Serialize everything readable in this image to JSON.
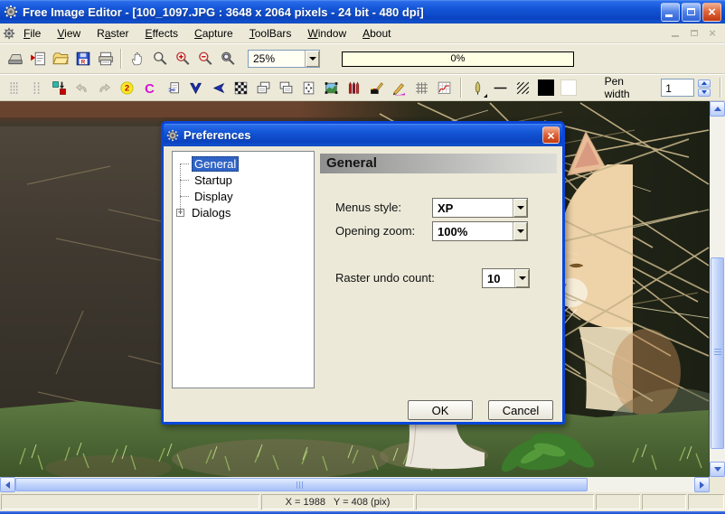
{
  "window": {
    "title": "Free Image Editor - [100_1097.JPG : 3648 x 2064 pixels - 24 bit - 480 dpi]",
    "controls": [
      "minimize",
      "restore",
      "close"
    ]
  },
  "menu": {
    "items": [
      {
        "label": "File",
        "mnemonic": "F"
      },
      {
        "label": "View",
        "mnemonic": "V"
      },
      {
        "label": "Raster",
        "mnemonic": "a"
      },
      {
        "label": "Effects",
        "mnemonic": "E"
      },
      {
        "label": "Capture",
        "mnemonic": "C"
      },
      {
        "label": "ToolBars",
        "mnemonic": "T"
      },
      {
        "label": "Window",
        "mnemonic": "W"
      },
      {
        "label": "About",
        "mnemonic": "A"
      }
    ]
  },
  "toolbar_main": {
    "zoom_value": "25%",
    "progress": "0%",
    "icons": [
      "scan-icon",
      "new-from-clipboard-icon",
      "open-icon",
      "save-icon",
      "print-icon",
      "hand-tool-icon",
      "zoom-tool-icon",
      "zoom-in-icon",
      "zoom-out-icon",
      "zoom-special-icon"
    ]
  },
  "toolbar_tools": {
    "pen_width_label": "Pen width",
    "pen_width_value": "1",
    "icons": [
      "column-guides-icon",
      "row-guides-icon",
      "color-swap-icon",
      "undo-icon",
      "redo-icon",
      "rotate-180-icon",
      "rotate-c-icon",
      "cut-region-icon",
      "flip-vertical-icon",
      "flip-horizontal-icon",
      "dither-pattern-icon",
      "bring-forward-icon",
      "send-backward-icon",
      "resize-canvas-icon",
      "image-frame-icon",
      "crayons-icon",
      "color-picker-icon",
      "draw-pencil-icon",
      "grid-icon",
      "histogram-icon",
      "pen-style-icon",
      "line-style-icon",
      "hatch-fill-icon",
      "foreground-color-swatch",
      "background-color-swatch"
    ]
  },
  "dialog": {
    "title": "Preferences",
    "tree": [
      {
        "label": "General",
        "selected": true,
        "expandable": false
      },
      {
        "label": "Startup",
        "selected": false,
        "expandable": false
      },
      {
        "label": "Display",
        "selected": false,
        "expandable": false
      },
      {
        "label": "Dialogs",
        "selected": false,
        "expandable": true
      }
    ],
    "expand_glyph": "+",
    "header": "General",
    "fields": [
      {
        "label": "Menus style:",
        "value": "XP"
      },
      {
        "label": "Opening zoom:",
        "value": "100%"
      },
      {
        "label": "Raster undo count:",
        "value": "10"
      }
    ],
    "buttons": {
      "ok": "OK",
      "cancel": "Cancel"
    }
  },
  "statusbar": {
    "coords": "X = 1988   Y = 408 (pix)"
  },
  "colors": {
    "titlebar_blue": "#1457d8",
    "dialog_border": "#0a46d8",
    "selection_blue": "#2f63c5",
    "toolbar_beige": "#ece9d8",
    "progress_bg": "#ffffe4"
  }
}
